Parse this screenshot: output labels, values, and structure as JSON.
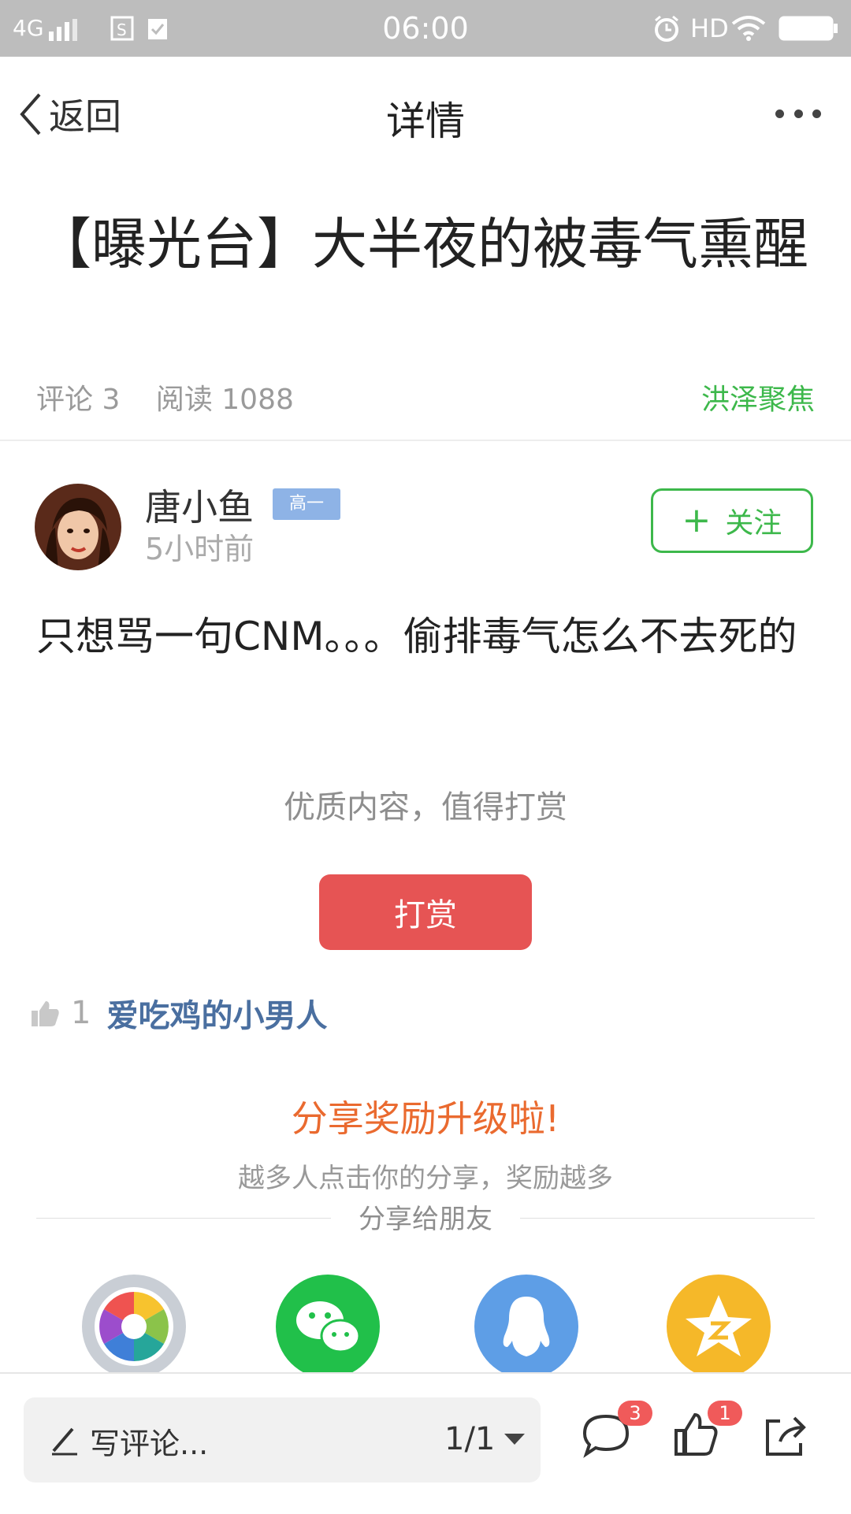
{
  "status_bar": {
    "network": "4G",
    "time": "06:00",
    "hd": "HD"
  },
  "nav": {
    "back_label": "返回",
    "title": "详情"
  },
  "article": {
    "title": "【曝光台】大半夜的被毒气熏醒",
    "comments_label": "评论 3",
    "reads_label": "阅读 1088",
    "source": "洪泽聚焦"
  },
  "author": {
    "name": "唐小鱼",
    "grade": "高一",
    "time": "5小时前",
    "follow_label": "关注"
  },
  "content": "只想骂一句CNM。。。偷排毒气怎么不去死的",
  "reward": {
    "hint": "优质内容，值得打赏",
    "button": "打赏"
  },
  "likes": {
    "count": "1",
    "user": "爱吃鸡的小男人"
  },
  "share": {
    "title": "分享奖励升级啦!",
    "subtitle": "越多人点击你的分享，奖励越多",
    "share_to": "分享给朋友",
    "targets": [
      "moments-icon",
      "wechat-icon",
      "qq-icon",
      "qzone-icon"
    ]
  },
  "bottom": {
    "comment_placeholder": "写评论...",
    "page_indicator": "1/1",
    "comment_badge": "3",
    "like_badge": "1"
  },
  "colors": {
    "accent_green": "#3db84b",
    "reward_red": "#e65454",
    "share_orange": "#ea6a2f",
    "like_name_blue": "#4a6fa0"
  }
}
